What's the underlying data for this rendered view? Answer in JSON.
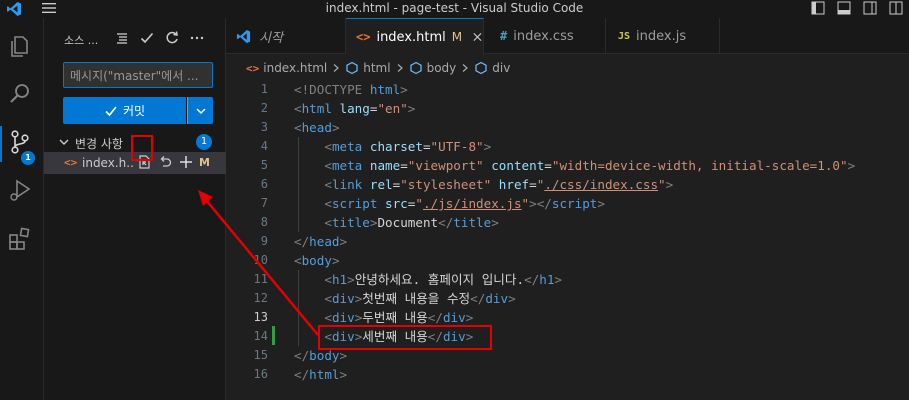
{
  "window": {
    "title": "index.html - page-test - Visual Studio Code"
  },
  "sidebar": {
    "title": "소스 ...",
    "commit_placeholder": "메시지(\"master\"에서 ...",
    "commit_label": "커밋",
    "changes_label": "변경 사항",
    "changes_count": "1",
    "activity_badge": "1",
    "file": {
      "name": "index.h...",
      "status": "M"
    }
  },
  "tabs": [
    {
      "label": "시작",
      "icon": "vscode-icon"
    },
    {
      "label": "index.html",
      "icon": "<>",
      "modified": "M"
    },
    {
      "label": "index.css",
      "icon": "#"
    },
    {
      "label": "index.js",
      "icon": "JS"
    }
  ],
  "breadcrumb": [
    "index.html",
    "html",
    "body",
    "div"
  ],
  "editor": {
    "current_line": 13,
    "lines": [
      [
        {
          "c": "t-br",
          "t": "<!DOCTYPE "
        },
        {
          "c": "t-tag",
          "t": "html"
        },
        {
          "c": "t-br",
          "t": ">"
        }
      ],
      [
        {
          "c": "t-br",
          "t": "<"
        },
        {
          "c": "t-tag",
          "t": "html "
        },
        {
          "c": "t-attr",
          "t": "lang"
        },
        {
          "c": "t-text",
          "t": "="
        },
        {
          "c": "t-str",
          "t": "\"en\""
        },
        {
          "c": "t-br",
          "t": ">"
        }
      ],
      [
        {
          "c": "t-br",
          "t": "<"
        },
        {
          "c": "t-tag",
          "t": "head"
        },
        {
          "c": "t-br",
          "t": ">"
        }
      ],
      [
        {
          "c": "t-text",
          "t": "    "
        },
        {
          "c": "t-br",
          "t": "<"
        },
        {
          "c": "t-tag",
          "t": "meta "
        },
        {
          "c": "t-attr",
          "t": "charset"
        },
        {
          "c": "t-text",
          "t": "="
        },
        {
          "c": "t-str",
          "t": "\"UTF-8\""
        },
        {
          "c": "t-br",
          "t": ">"
        }
      ],
      [
        {
          "c": "t-text",
          "t": "    "
        },
        {
          "c": "t-br",
          "t": "<"
        },
        {
          "c": "t-tag",
          "t": "meta "
        },
        {
          "c": "t-attr",
          "t": "name"
        },
        {
          "c": "t-text",
          "t": "="
        },
        {
          "c": "t-str",
          "t": "\"viewport\" "
        },
        {
          "c": "t-attr",
          "t": "content"
        },
        {
          "c": "t-text",
          "t": "="
        },
        {
          "c": "t-str",
          "t": "\"width=device-width, initial-scale=1.0\""
        },
        {
          "c": "t-br",
          "t": ">"
        }
      ],
      [
        {
          "c": "t-text",
          "t": "    "
        },
        {
          "c": "t-br",
          "t": "<"
        },
        {
          "c": "t-tag",
          "t": "link "
        },
        {
          "c": "t-attr",
          "t": "rel"
        },
        {
          "c": "t-text",
          "t": "="
        },
        {
          "c": "t-str",
          "t": "\"stylesheet\" "
        },
        {
          "c": "t-attr",
          "t": "href"
        },
        {
          "c": "t-text",
          "t": "="
        },
        {
          "c": "t-str",
          "t": "\""
        },
        {
          "c": "t-link",
          "t": "./css/index.css"
        },
        {
          "c": "t-str",
          "t": "\""
        },
        {
          "c": "t-br",
          "t": ">"
        }
      ],
      [
        {
          "c": "t-text",
          "t": "    "
        },
        {
          "c": "t-br",
          "t": "<"
        },
        {
          "c": "t-tag",
          "t": "script "
        },
        {
          "c": "t-attr",
          "t": "src"
        },
        {
          "c": "t-text",
          "t": "="
        },
        {
          "c": "t-str",
          "t": "\""
        },
        {
          "c": "t-link",
          "t": "./js/index.js"
        },
        {
          "c": "t-str",
          "t": "\""
        },
        {
          "c": "t-br",
          "t": "></"
        },
        {
          "c": "t-tag",
          "t": "script"
        },
        {
          "c": "t-br",
          "t": ">"
        }
      ],
      [
        {
          "c": "t-text",
          "t": "    "
        },
        {
          "c": "t-br",
          "t": "<"
        },
        {
          "c": "t-tag",
          "t": "title"
        },
        {
          "c": "t-br",
          "t": ">"
        },
        {
          "c": "t-text",
          "t": "Document"
        },
        {
          "c": "t-br",
          "t": "</"
        },
        {
          "c": "t-tag",
          "t": "title"
        },
        {
          "c": "t-br",
          "t": ">"
        }
      ],
      [
        {
          "c": "t-br",
          "t": "</"
        },
        {
          "c": "t-tag",
          "t": "head"
        },
        {
          "c": "t-br",
          "t": ">"
        }
      ],
      [
        {
          "c": "t-br",
          "t": "<"
        },
        {
          "c": "t-tag",
          "t": "body"
        },
        {
          "c": "t-br",
          "t": ">"
        }
      ],
      [
        {
          "c": "t-text",
          "t": "    "
        },
        {
          "c": "t-br",
          "t": "<"
        },
        {
          "c": "t-tag",
          "t": "h1"
        },
        {
          "c": "t-br",
          "t": ">"
        },
        {
          "c": "t-text",
          "t": "안녕하세요. 홈페이지 입니다."
        },
        {
          "c": "t-br",
          "t": "</"
        },
        {
          "c": "t-tag",
          "t": "h1"
        },
        {
          "c": "t-br",
          "t": ">"
        }
      ],
      [
        {
          "c": "t-text",
          "t": "    "
        },
        {
          "c": "t-br",
          "t": "<"
        },
        {
          "c": "t-tag",
          "t": "div"
        },
        {
          "c": "t-br",
          "t": ">"
        },
        {
          "c": "t-text",
          "t": "첫번째 내용을 수정"
        },
        {
          "c": "t-br",
          "t": "</"
        },
        {
          "c": "t-tag",
          "t": "div"
        },
        {
          "c": "t-br",
          "t": ">"
        }
      ],
      [
        {
          "c": "t-text",
          "t": "    "
        },
        {
          "c": "t-br",
          "t": "<"
        },
        {
          "c": "t-tag",
          "t": "div"
        },
        {
          "c": "t-br",
          "t": ">"
        },
        {
          "c": "t-text",
          "t": "두번째 내용"
        },
        {
          "c": "t-br",
          "t": "</"
        },
        {
          "c": "t-tag",
          "t": "div"
        },
        {
          "c": "t-br",
          "t": ">"
        }
      ],
      [
        {
          "c": "t-text",
          "t": "    "
        },
        {
          "c": "t-br",
          "t": "<"
        },
        {
          "c": "t-tag",
          "t": "div"
        },
        {
          "c": "t-br",
          "t": ">"
        },
        {
          "c": "t-text",
          "t": "세번째 내용"
        },
        {
          "c": "t-br",
          "t": "</"
        },
        {
          "c": "t-tag",
          "t": "div"
        },
        {
          "c": "t-br",
          "t": ">"
        }
      ],
      [
        {
          "c": "t-br",
          "t": "</"
        },
        {
          "c": "t-tag",
          "t": "body"
        },
        {
          "c": "t-br",
          "t": ">"
        }
      ],
      [
        {
          "c": "t-br",
          "t": "</"
        },
        {
          "c": "t-tag",
          "t": "html"
        },
        {
          "c": "t-br",
          "t": ">"
        }
      ]
    ]
  },
  "colors": {
    "accent": "#0078d4",
    "annotation": "#e30000",
    "modified": "#e2c08d",
    "added_gutter": "#2ea043"
  }
}
